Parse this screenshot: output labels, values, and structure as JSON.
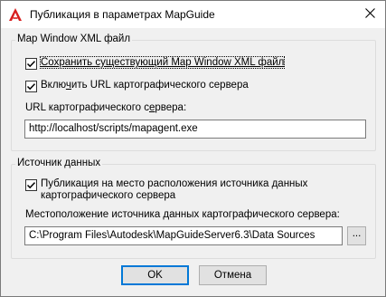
{
  "window": {
    "title": "Публикация в параметрах MapGuide",
    "close_glyph": "✕"
  },
  "map_window_group": {
    "title": "Map Window XML файл",
    "save_checkbox": {
      "label": "Сохранить существующий Map Window XML файл",
      "checked": true
    },
    "include_url_checkbox": {
      "label_pre": "Вклю",
      "label_accel": "ч",
      "label_post": "ить URL картографического сервера",
      "checked": true
    },
    "url_label_pre": "URL картографического с",
    "url_label_accel": "е",
    "url_label_post": "рвера:",
    "url_value": "http://localhost/scripts/mapagent.exe"
  },
  "data_source_group": {
    "title": "Источник данных",
    "publish_checkbox": {
      "label_line1": "Публикация на место расположения источника данных",
      "label_line2": "картографического сервера",
      "checked": true
    },
    "location_label_pre": "Местоположение источника ",
    "location_label_accel": "д",
    "location_label_post": "анных картографического сервера:",
    "location_value": "C:\\Program Files\\Autodesk\\MapGuideServer6.3\\Data Sources",
    "browse_label": "..."
  },
  "buttons": {
    "ok": "OK",
    "cancel": "Отмена"
  },
  "icons": {
    "app": "autocad-a-icon",
    "close": "close-icon",
    "check": "checkmark-icon"
  },
  "colors": {
    "accent": "#0078d7",
    "app_icon": "#d81e1e"
  }
}
